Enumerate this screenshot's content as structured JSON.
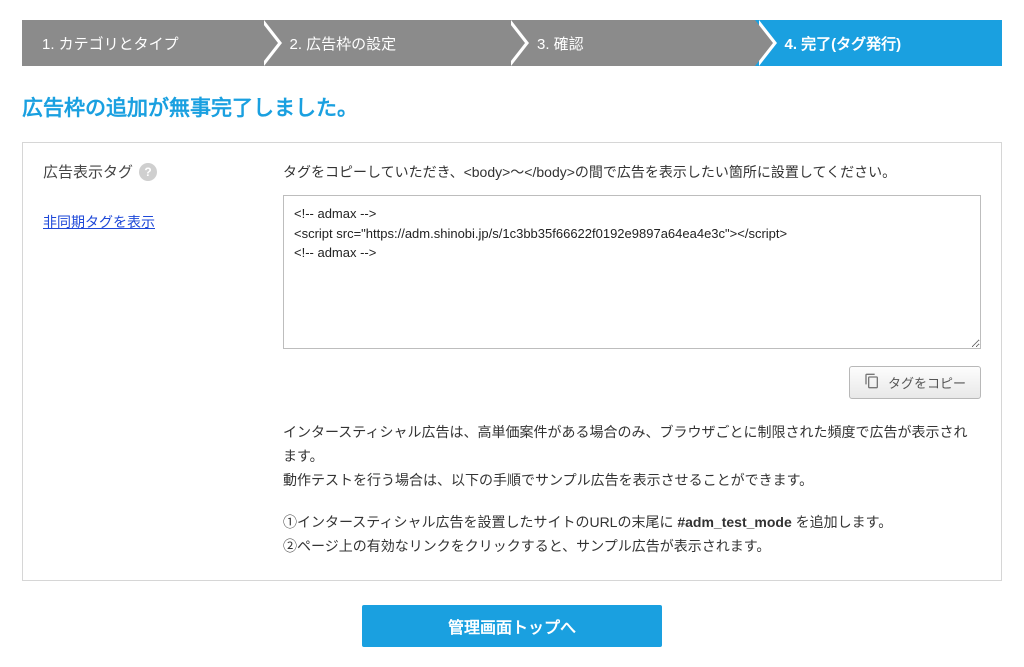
{
  "steps": {
    "s1": "1. カテゴリとタイプ",
    "s2": "2. 広告枠の設定",
    "s3": "3. 確認",
    "s4": "4. 完了(タグ発行)"
  },
  "title": "広告枠の追加が無事完了しました。",
  "left": {
    "label": "広告表示タグ",
    "help_icon": "?",
    "async_link": "非同期タグを表示"
  },
  "right": {
    "instruction": "タグをコピーしていただき、<body>〜</body>の間で広告を表示したい箇所に設置してください。",
    "tag_code": "<!-- admax -->\n<script src=\"https://adm.shinobi.jp/s/1c3bb35f66622f0192e9897a64ea4e3c\"></script>\n<!-- admax -->",
    "copy_button": "タグをコピー",
    "note_line1": "インタースティシャル広告は、高単価案件がある場合のみ、ブラウザごとに制限された頻度で広告が表示されます。",
    "note_line2": "動作テストを行う場合は、以下の手順でサンプル広告を表示させることができます。",
    "step1_pre": "①インタースティシャル広告を設置したサイトのURLの末尾に ",
    "step1_bold": "#adm_test_mode",
    "step1_post": " を追加します。",
    "step2": "②ページ上の有効なリンクをクリックすると、サンプル広告が表示されます。"
  },
  "footer_button": "管理画面トップへ"
}
